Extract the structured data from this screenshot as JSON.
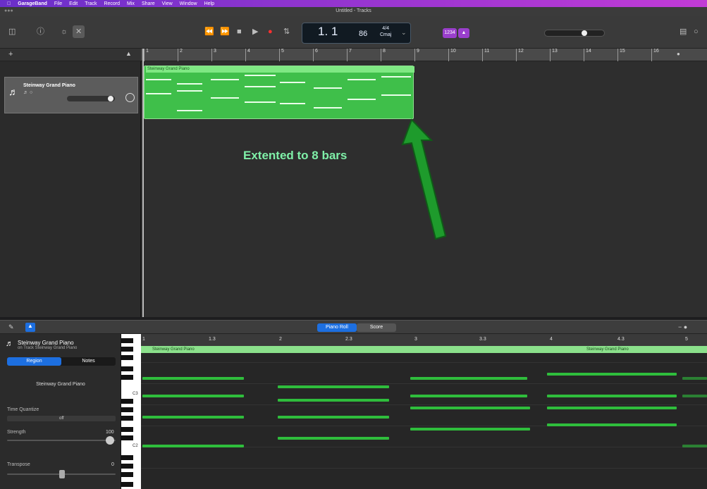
{
  "menubar": {
    "apple": "",
    "items": [
      "GarageBand",
      "File",
      "Edit",
      "Track",
      "Record",
      "Mix",
      "Share",
      "View",
      "Window",
      "Help"
    ]
  },
  "window": {
    "title": "Untitled - Tracks"
  },
  "toolbar": {
    "lcd_bar": "1. 1",
    "lcd_tempo": "86",
    "lcd_sig_top": "4/4",
    "lcd_sig_bottom": "Cmaj",
    "count_in": "1234"
  },
  "tracks": [
    {
      "name": "Steinway Grand Piano"
    }
  ],
  "ruler": {
    "bars": [
      "1",
      "2",
      "3",
      "4",
      "5",
      "6",
      "7",
      "8",
      "9",
      "10",
      "11",
      "12",
      "13",
      "14",
      "15",
      "16"
    ]
  },
  "region": {
    "name": "Steinway Grand Piano",
    "length_bars": 8
  },
  "annotation": "Extented to 8 bars",
  "editor": {
    "tabs": [
      "Piano Roll",
      "Score"
    ],
    "track_title": "Steinway Grand Piano",
    "track_subtitle": "on Track Steinway Grand Piano",
    "inspector_tabs": [
      "Region",
      "Notes"
    ],
    "region_name": "Steinway Grand Piano",
    "time_quantize_label": "Time Quantize",
    "time_quantize_value": "off",
    "strength_label": "Strength",
    "strength_value": "100",
    "transpose_label": "Transpose",
    "transpose_value": "0",
    "roll_ruler": [
      "1",
      "1.3",
      "2",
      "2.3",
      "3",
      "3.3",
      "4",
      "4.3",
      "5"
    ],
    "roll_region_left": "Steinway Grand Piano",
    "roll_region_right": "Steinway Grand Piano",
    "key_labels": [
      "C3",
      "C2"
    ]
  },
  "colors": {
    "region": "#3fbf4a",
    "accent": "#1d6fe0",
    "annotation": "#7ff0a8",
    "arrow": "#1e9b2c"
  }
}
